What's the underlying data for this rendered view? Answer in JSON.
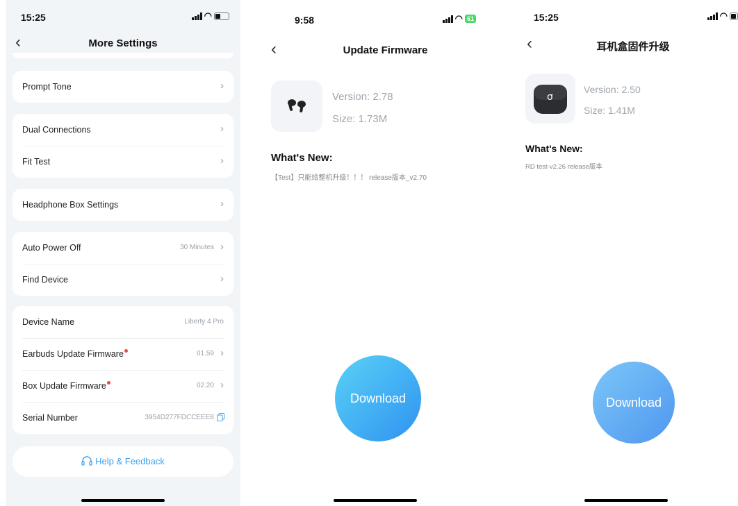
{
  "panel1": {
    "time": "15:25",
    "title": "More Settings",
    "items": {
      "prompt_tone": "Prompt Tone",
      "dual_connections": "Dual Connections",
      "fit_test": "Fit Test",
      "headphone_box_settings": "Headphone Box Settings",
      "auto_power_off": "Auto Power Off",
      "auto_power_off_value": "30 Minutes",
      "find_device": "Find Device",
      "device_name": "Device Name",
      "device_name_value": "Liberty 4 Pro",
      "earbuds_update": "Earbuds Update Firmware",
      "earbuds_update_value": "01.59",
      "box_update": "Box Update Firmware",
      "box_update_value": "02.20",
      "serial_number": "Serial Number",
      "serial_number_value": "3954D277FDCCEEE8"
    },
    "help_label": "Help & Feedback"
  },
  "panel2": {
    "time": "9:58",
    "battery": "61",
    "title": "Update Firmware",
    "version": "Version: 2.78",
    "size": "Size: 1.73M",
    "whats_new_label": "What's New:",
    "whats_new_text": "【Test】只能给整机升级！！！ release版本_v2.70",
    "download_label": "Download"
  },
  "panel3": {
    "time": "15:25",
    "title": "耳机盒固件升级",
    "version": "Version: 2.50",
    "size": "Size: 1.41M",
    "whats_new_label": "What's New:",
    "whats_new_text": "RD test-v2.26 release版本",
    "download_label": "Download"
  },
  "colors": {
    "accent": "#3aa3f0",
    "settings_bg": "#f2f5f8",
    "notify_dot": "#e74c3c"
  },
  "icons": [
    "back-chevron-icon",
    "chevron-right-icon",
    "copy-icon",
    "headset-icon",
    "signal-icon",
    "wifi-icon",
    "battery-icon",
    "earbuds-icon",
    "charging-case-icon"
  ]
}
